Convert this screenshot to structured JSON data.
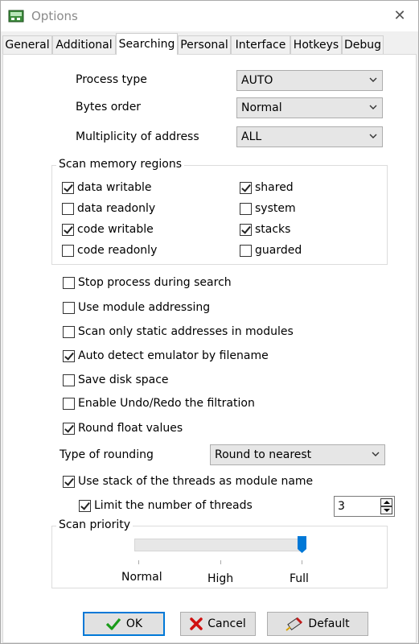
{
  "window": {
    "title": "Options",
    "close_label": "✕"
  },
  "tabs": [
    {
      "label": "General"
    },
    {
      "label": "Additional"
    },
    {
      "label": "Searching"
    },
    {
      "label": "Personal"
    },
    {
      "label": "Interface"
    },
    {
      "label": "Hotkeys"
    },
    {
      "label": "Debug"
    }
  ],
  "active_tab": "Searching",
  "settings": {
    "process_type": {
      "label": "Process type",
      "value": "AUTO"
    },
    "bytes_order": {
      "label": "Bytes order",
      "value": "Normal"
    },
    "multiplicity": {
      "label": "Multiplicity of address",
      "value": "ALL"
    }
  },
  "scan_regions": {
    "title": "Scan memory regions",
    "items": [
      {
        "label": "data writable",
        "checked": true
      },
      {
        "label": "data readonly",
        "checked": false
      },
      {
        "label": "code writable",
        "checked": true
      },
      {
        "label": "code readonly",
        "checked": false
      },
      {
        "label": "shared",
        "checked": true
      },
      {
        "label": "system",
        "checked": false
      },
      {
        "label": "stacks",
        "checked": true
      },
      {
        "label": "guarded",
        "checked": false
      }
    ]
  },
  "options": [
    {
      "label": "Stop process during search",
      "checked": false
    },
    {
      "label": "Use module addressing",
      "checked": false
    },
    {
      "label": "Scan only static addresses in modules",
      "checked": false
    },
    {
      "label": "Auto detect emulator by filename",
      "checked": true
    },
    {
      "label": "Save disk space",
      "checked": false
    },
    {
      "label": "Enable Undo/Redo the filtration",
      "checked": false
    },
    {
      "label": "Round float values",
      "checked": true
    }
  ],
  "rounding": {
    "label": "Type of rounding",
    "value": "Round to nearest"
  },
  "threads": {
    "use_stack": {
      "label": "Use stack of the threads as module name",
      "checked": true
    },
    "limit": {
      "label": "Limit the number of threads",
      "checked": true,
      "value": "3"
    }
  },
  "priority": {
    "title": "Scan priority",
    "labels": [
      "Normal",
      "High",
      "Full"
    ],
    "selected_index": 2
  },
  "buttons": {
    "ok": "OK",
    "cancel": "Cancel",
    "default": "Default"
  },
  "colors": {
    "accent": "#0078d7",
    "ok_check": "#1a9b1a",
    "cancel_x": "#d01010"
  }
}
